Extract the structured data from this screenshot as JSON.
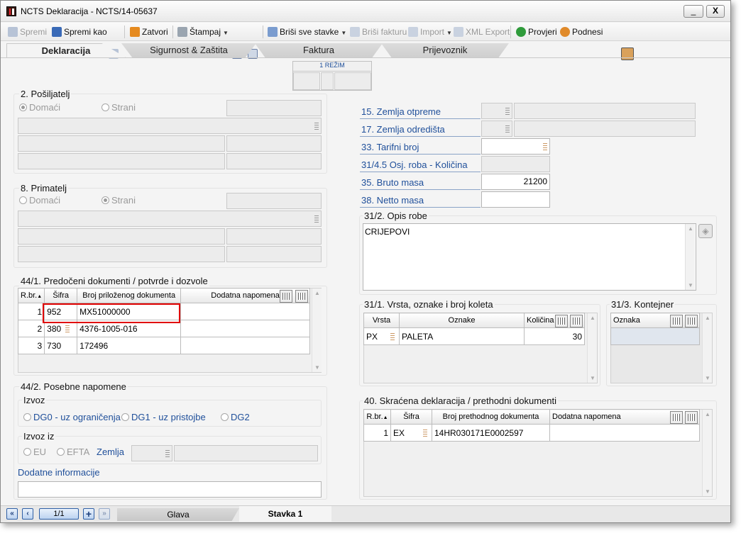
{
  "window": {
    "title": "NCTS Deklaracija - NCTS/14-05637",
    "minimize": "_",
    "close": "X"
  },
  "toolbar": {
    "spremi": "Spremi",
    "spremi_kao": "Spremi kao",
    "zatvori": "Zatvori",
    "stampaj": "Štampaj",
    "brisi_stavke": "Briši sve stavke",
    "brisi_fakturu": "Briši fakturu",
    "import": "Import",
    "xml_export": "XML Export",
    "provjeri": "Provjeri",
    "podnesi": "Podnesi"
  },
  "tabs": [
    "Deklaracija",
    "Sigurnost & Zaštita",
    "Faktura",
    "Prijevoznik"
  ],
  "rezim": {
    "label": "1 REŽIM"
  },
  "posiljatelj": {
    "title": "2. Pošiljatelj",
    "r1": "Domaći",
    "r2": "Strani"
  },
  "primatelj": {
    "title": "8. Primatelj",
    "r1": "Domaći",
    "r2": "Strani"
  },
  "right_fields": {
    "zemlja_otpreme": "15. Zemlja otpreme",
    "zemlja_odredista": "17. Zemlja odredišta",
    "tarifni_broj": "33. Tarifni broj",
    "osj_roba": "31/4.5  Osj. roba - Količina",
    "bruto_masa": "35. Bruto masa",
    "bruto_value": "21200",
    "netto_masa": "38. Netto masa"
  },
  "opis": {
    "title": "31/2. Opis robe",
    "text": "CRIJEPOVI"
  },
  "dokumenti": {
    "title": "44/1. Predočeni dokumenti / potvrde i dozvole",
    "headers": [
      "R.br.",
      "Šifra",
      "Broj priloženog dokumenta",
      "Dodatna napomena"
    ],
    "rows": [
      [
        "1",
        "952",
        "MX51000000",
        ""
      ],
      [
        "2",
        "380",
        "4376-1005-016",
        ""
      ],
      [
        "3",
        "730",
        "172496",
        ""
      ]
    ]
  },
  "napomene": {
    "title": "44/2. Posebne napomene",
    "izvoz": "Izvoz",
    "dg0": "DG0 - uz ograničenja",
    "dg1": "DG1 - uz pristojbe",
    "dg2": "DG2",
    "izvoz_iz": "Izvoz iz",
    "eu": "EU",
    "efta": "EFTA",
    "zemlja": "Zemlja",
    "dodatne": "Dodatne informacije"
  },
  "koleta": {
    "title": "31/1. Vrsta, oznake i broj koleta",
    "headers": [
      "Vrsta",
      "Oznake",
      "Količina"
    ],
    "rows": [
      [
        "PX",
        "PALETA",
        "30"
      ]
    ]
  },
  "kontejner": {
    "title": "31/3. Kontejner",
    "header": "Oznaka"
  },
  "prethodni": {
    "title": "40. Skraćena deklaracija / prethodni dokumenti",
    "headers": [
      "R.br.",
      "Šifra",
      "Broj prethodnog dokumenta",
      "Dodatna napomena"
    ],
    "rows": [
      [
        "1",
        "EX",
        "14HR030171E0002597",
        ""
      ]
    ]
  },
  "statusbar": {
    "page": "1/1",
    "glava": "Glava",
    "stavka": "Stavka 1"
  },
  "colors": {
    "highlight": "#e00000",
    "label_blue": "#1f4f9a"
  }
}
